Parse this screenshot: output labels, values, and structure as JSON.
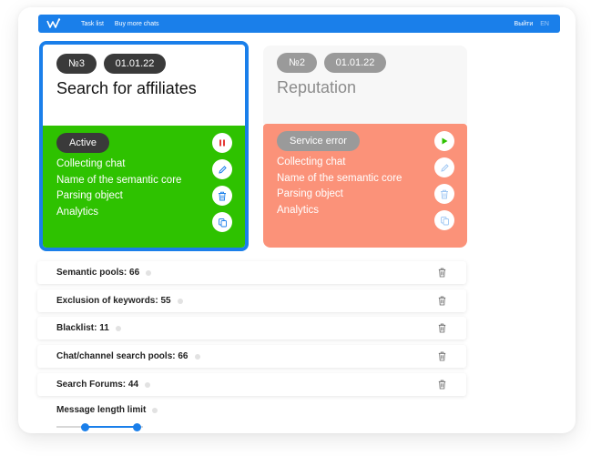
{
  "nav": {
    "logo": "logo-icon",
    "links": [
      "Task list",
      "Buy more chats"
    ],
    "logout": "Выйти",
    "lang": "EN"
  },
  "cards": [
    {
      "number": "№3",
      "date": "01.01.22",
      "title": "Search for affiliates",
      "status": "Active",
      "props": [
        "Collecting chat",
        "Name of the semantic core",
        "Parsing object",
        "Analytics"
      ],
      "actions": [
        "pause-icon",
        "edit-icon",
        "trash-icon",
        "copy-icon"
      ],
      "color": "#2ec200"
    },
    {
      "number": "№2",
      "date": "01.01.22",
      "title": "Reputation",
      "status": "Service error",
      "props": [
        "Collecting chat",
        "Name of the semantic core",
        "Parsing object",
        "Analytics"
      ],
      "actions": [
        "play-icon",
        "edit-icon",
        "trash-icon",
        "copy-icon"
      ],
      "color": "#fb9279"
    }
  ],
  "rows": [
    {
      "label": "Semantic pools: 66"
    },
    {
      "label": "Exclusion of keywords: 55"
    },
    {
      "label": "Blacklist: 11"
    },
    {
      "label": "Chat/channel search pools: 66"
    },
    {
      "label": "Search Forums: 44"
    }
  ],
  "limit": {
    "label": "Message length limit",
    "range_low": 0.33,
    "range_high": 0.93
  },
  "colors": {
    "accent": "#1a7fea",
    "active": "#2ec200",
    "error": "#fb9279",
    "pause": "#e53935",
    "play": "#2ec200"
  }
}
